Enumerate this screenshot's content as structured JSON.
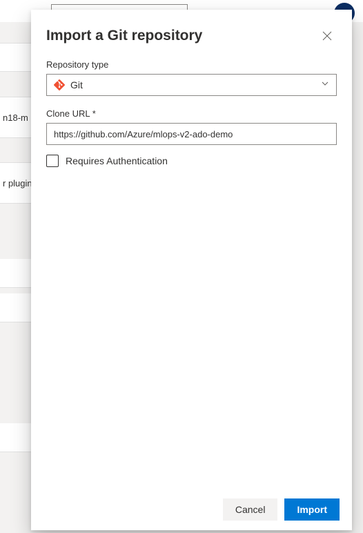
{
  "background": {
    "row1_text": "n18-m",
    "row2_text": "r plugin"
  },
  "modal": {
    "title": "Import a Git repository",
    "repository_type": {
      "label": "Repository type",
      "selected": "Git"
    },
    "clone_url": {
      "label": "Clone URL *",
      "value": "https://github.com/Azure/mlops-v2-ado-demo"
    },
    "requires_auth": {
      "label": "Requires Authentication"
    },
    "buttons": {
      "cancel": "Cancel",
      "import": "Import"
    }
  }
}
